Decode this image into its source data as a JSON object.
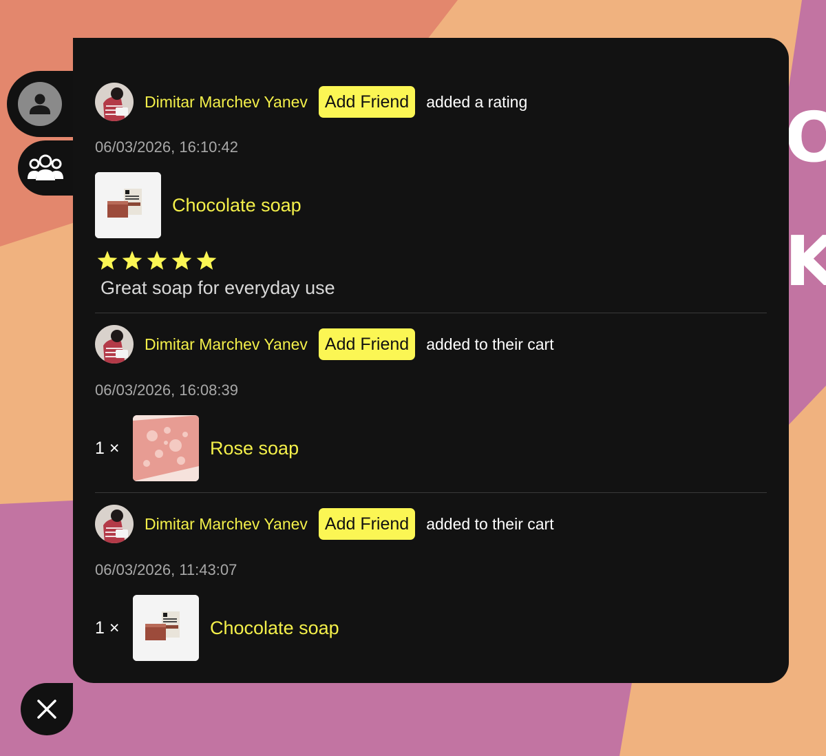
{
  "colors": {
    "panel": "#121212",
    "accent_yellow": "#fbf654",
    "link_yellow": "#f4f04a",
    "bg_coral": "#e3876d",
    "bg_peach": "#f0b27f",
    "bg_pink": "#c274a2"
  },
  "background": {
    "text_1": "O",
    "text_2": "K"
  },
  "side_tabs": {
    "profile_icon": "person-icon",
    "friends_icon": "group-icon"
  },
  "close_button": {
    "icon": "close-icon"
  },
  "feed": [
    {
      "user": "Dimitar Marchev Yanev",
      "add_friend": "Add Friend",
      "action": "added a rating",
      "timestamp": "06/03/2026, 16:10:42",
      "product": "Chocolate soap",
      "rating": 5,
      "comment": "Great soap for everyday use"
    },
    {
      "user": "Dimitar Marchev Yanev",
      "add_friend": "Add Friend",
      "action": "added to their cart",
      "timestamp": "06/03/2026, 16:08:39",
      "quantity": "1 ×",
      "product": "Rose soap"
    },
    {
      "user": "Dimitar Marchev Yanev",
      "add_friend": "Add Friend",
      "action": "added to their cart",
      "timestamp": "06/03/2026, 11:43:07",
      "quantity": "1 ×",
      "product": "Chocolate soap"
    }
  ]
}
